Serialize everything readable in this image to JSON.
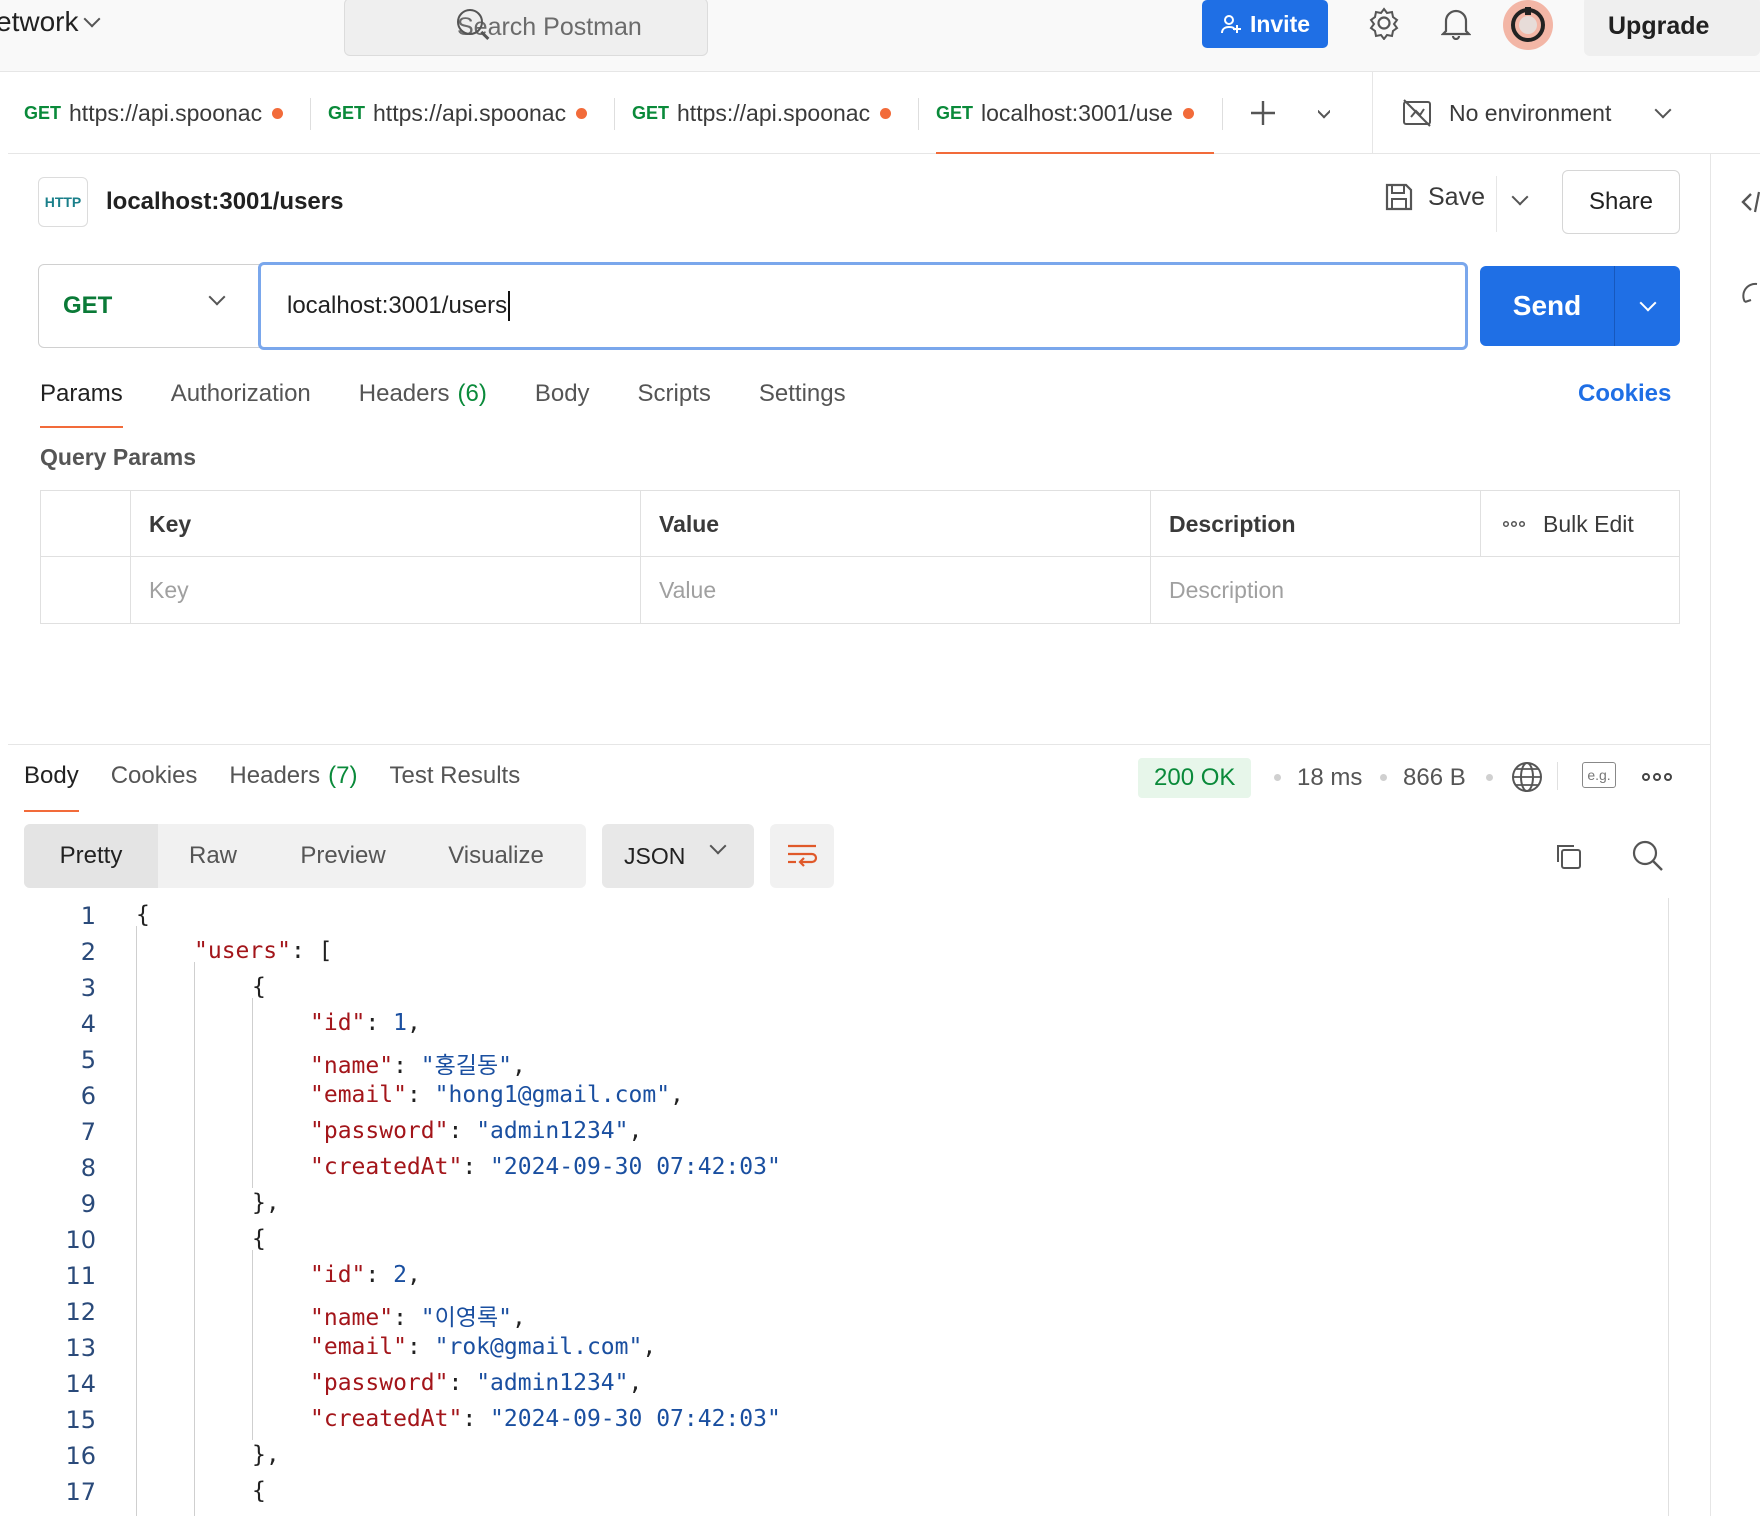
{
  "topbar": {
    "workspace": "etwork",
    "search_placeholder": "Search Postman",
    "invite_label": "Invite",
    "upgrade_label": "Upgrade"
  },
  "tabs": [
    {
      "method": "GET",
      "label": "https://api.spoonac",
      "unsaved": true
    },
    {
      "method": "GET",
      "label": "https://api.spoonac",
      "unsaved": true
    },
    {
      "method": "GET",
      "label": "https://api.spoonac",
      "unsaved": true
    },
    {
      "method": "GET",
      "label": "localhost:3001/use",
      "unsaved": true,
      "active": true
    }
  ],
  "environment": {
    "label": "No environment"
  },
  "request": {
    "badge": "HTTP",
    "title": "localhost:3001/users",
    "save_label": "Save",
    "share_label": "Share",
    "method": "GET",
    "url": "localhost:3001/users",
    "send_label": "Send"
  },
  "request_tabs": [
    {
      "label": "Params",
      "active": true
    },
    {
      "label": "Authorization"
    },
    {
      "label": "Headers",
      "count": "(6)"
    },
    {
      "label": "Body"
    },
    {
      "label": "Scripts"
    },
    {
      "label": "Settings"
    }
  ],
  "cookies_link": "Cookies",
  "query_params": {
    "title": "Query Params",
    "headers": [
      "Key",
      "Value",
      "Description"
    ],
    "bulk_edit": "Bulk Edit",
    "placeholders": [
      "Key",
      "Value",
      "Description"
    ]
  },
  "response": {
    "tabs": [
      {
        "label": "Body",
        "active": true
      },
      {
        "label": "Cookies"
      },
      {
        "label": "Headers",
        "count": "(7)"
      },
      {
        "label": "Test Results"
      }
    ],
    "status": "200 OK",
    "time": "18 ms",
    "size": "866 B",
    "example_icon": "e.g.",
    "formats": [
      "Pretty",
      "Raw",
      "Preview",
      "Visualize"
    ],
    "active_format": "Pretty",
    "language": "JSON"
  },
  "code_lines": [
    {
      "n": "1"
    },
    {
      "n": "2"
    },
    {
      "n": "3"
    },
    {
      "n": "4"
    },
    {
      "n": "5"
    },
    {
      "n": "6"
    },
    {
      "n": "7"
    },
    {
      "n": "8"
    },
    {
      "n": "9"
    },
    {
      "n": "10"
    },
    {
      "n": "11"
    },
    {
      "n": "12"
    },
    {
      "n": "13"
    },
    {
      "n": "14"
    },
    {
      "n": "15"
    },
    {
      "n": "16"
    },
    {
      "n": "17"
    }
  ],
  "json": {
    "users_key": "\"users\"",
    "id_key": "\"id\"",
    "name_key": "\"name\"",
    "email_key": "\"email\"",
    "password_key": "\"password\"",
    "createdAt_key": "\"createdAt\"",
    "user1": {
      "id": "1",
      "name": "\"홍길동\"",
      "email": "\"hong1@gmail.com\"",
      "password": "\"admin1234\"",
      "createdAt": "\"2024-09-30 07:42:03\""
    },
    "user2": {
      "id": "2",
      "name": "\"이영록\"",
      "email": "\"rok@gmail.com\"",
      "password": "\"admin1234\"",
      "createdAt": "\"2024-09-30 07:42:03\""
    }
  },
  "colors": {
    "accent": "#1f6fe5",
    "tab_indicator": "#f26b3a",
    "method_get": "#0a8a3a",
    "json_key": "#a3151a",
    "json_string": "#1a4fa0"
  }
}
